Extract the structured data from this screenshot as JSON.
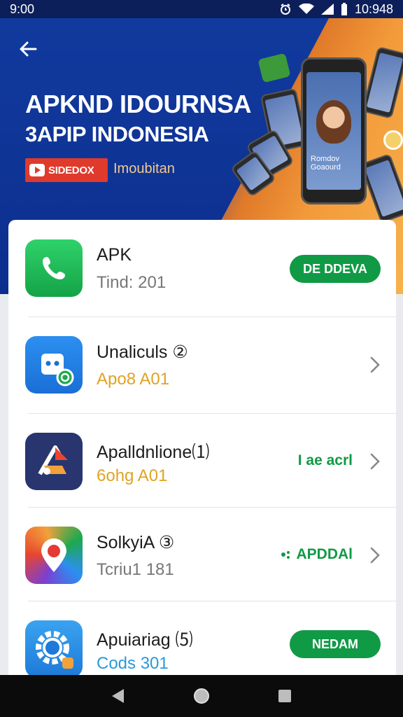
{
  "status_bar": {
    "left_text": "9:00",
    "time": "10:948"
  },
  "hero": {
    "title": "APKND IDOURNSA",
    "subtitle": "3APIP INDONESIA",
    "badge_label": "SIDEDOX",
    "tagline": "Imoubitan",
    "phone_caption_line1": "Romdov",
    "phone_caption_line2": "Goaourd"
  },
  "apps": [
    {
      "name": "APK",
      "meta": "Tind: 201",
      "action": "DE DDEVA",
      "meta_color": "#777777"
    },
    {
      "name": "Unaliculs ②",
      "meta": "Apo8 A01",
      "meta_color": "#e0a323"
    },
    {
      "name": "Apalldnlione⑴",
      "meta": "6ohg A01",
      "link": "I ae acrl",
      "meta_color": "#e0a323"
    },
    {
      "name": "SolkyiA ③",
      "meta": "Tcriu1 181",
      "link": "APDDAl",
      "meta_color": "#777777"
    },
    {
      "name": "Apuiariag ⑸",
      "meta": "Cods 301",
      "action": "NEDAM",
      "meta_color": "#2a9ad8"
    }
  ],
  "colors": {
    "accent_green": "#109a45",
    "hero_blue": "#113a9e",
    "hero_orange": "#f39a3a",
    "nav_bg": "#0b0b0b"
  },
  "icons": [
    "back-arrow",
    "phone-handset",
    "chat-bot",
    "abstract-a",
    "maps-pin",
    "settings-gear",
    "chevron-right",
    "nav-back",
    "nav-home",
    "nav-recents",
    "alarm",
    "wifi",
    "signal",
    "battery"
  ]
}
